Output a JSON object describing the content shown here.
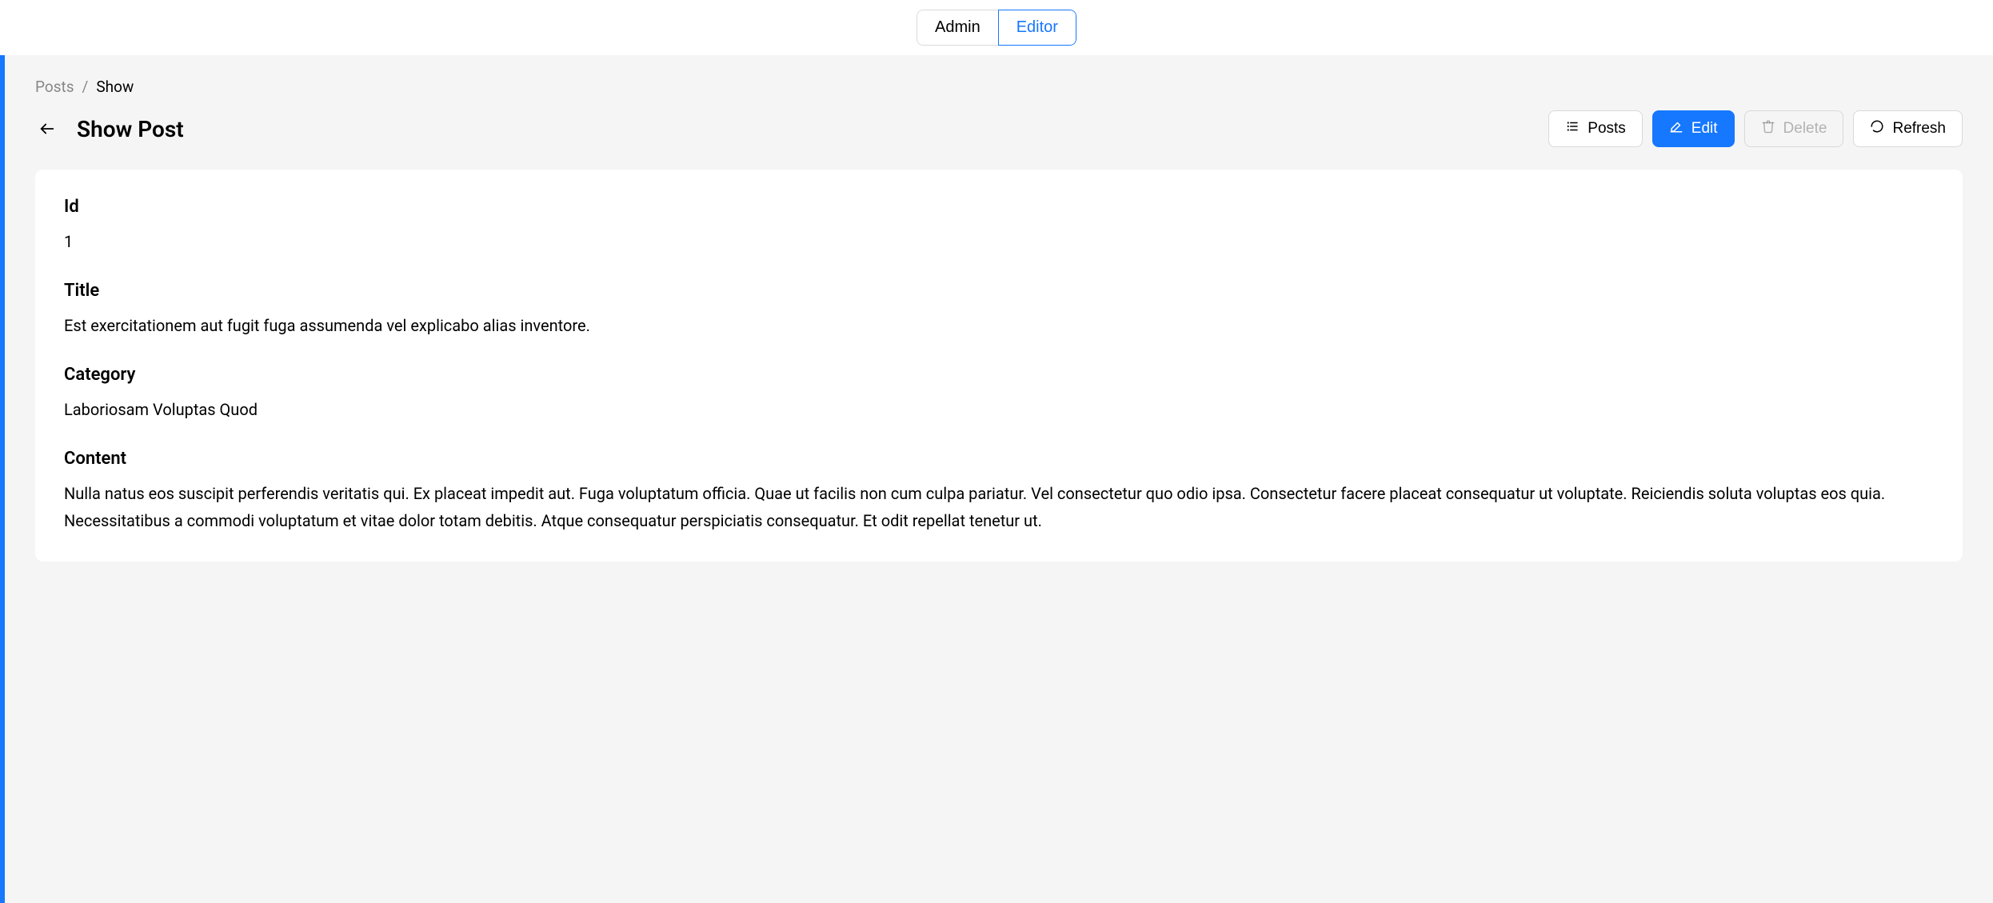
{
  "roles": {
    "admin": "Admin",
    "editor": "Editor"
  },
  "breadcrumb": {
    "parent": "Posts",
    "current": "Show"
  },
  "pageTitle": "Show Post",
  "actions": {
    "posts": "Posts",
    "edit": "Edit",
    "delete": "Delete",
    "refresh": "Refresh"
  },
  "fields": {
    "id": {
      "label": "Id",
      "value": "1"
    },
    "title": {
      "label": "Title",
      "value": "Est exercitationem aut fugit fuga assumenda vel explicabo alias inventore."
    },
    "category": {
      "label": "Category",
      "value": "Laboriosam Voluptas Quod"
    },
    "content": {
      "label": "Content",
      "value": "Nulla natus eos suscipit perferendis veritatis qui. Ex placeat impedit aut. Fuga voluptatum officia. Quae ut facilis non cum culpa pariatur. Vel consectetur quo odio ipsa. Consectetur facere placeat consequatur ut voluptate. Reiciendis soluta voluptas eos quia. Necessitatibus a commodi voluptatum et vitae dolor totam debitis. Atque consequatur perspiciatis consequatur. Et odit repellat tenetur ut."
    }
  }
}
